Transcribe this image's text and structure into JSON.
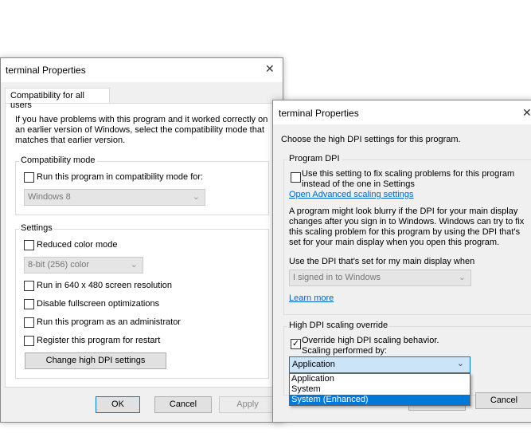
{
  "left_dialog": {
    "title": "terminal Properties",
    "tab": "Compatibility for all users",
    "intro": "If you have problems with this program and it worked correctly on an earlier version of Windows, select the compatibility mode that matches that earlier version.",
    "compat_group": "Compatibility mode",
    "compat_checkbox": "Run this program in compatibility mode for:",
    "compat_select": "Windows 8",
    "settings_group": "Settings",
    "reduced_color": "Reduced color mode",
    "color_select": "8-bit (256) color",
    "res640": "Run in 640 x 480 screen resolution",
    "fullscreen": "Disable fullscreen optimizations",
    "admin": "Run this program as an administrator",
    "restart": "Register this program for restart",
    "dpi_button": "Change high DPI settings",
    "ok": "OK",
    "cancel": "Cancel",
    "apply": "Apply"
  },
  "right_dialog": {
    "title": "terminal Properties",
    "heading": "Choose the high DPI settings for this program.",
    "program_dpi_group": "Program DPI",
    "program_dpi_checkbox": "Use this setting to fix scaling problems for this program instead of the one in Settings",
    "advanced_link": "Open Advanced scaling settings",
    "blurry_text": "A program might look blurry if the DPI for your main display changes after you sign in to Windows. Windows can try to fix this scaling problem for this program by using the DPI that's set for your main display when you open this program.",
    "use_dpi_label": "Use the DPI that's set for my main display when",
    "signin_select": "I signed in to Windows",
    "learn_more": "Learn more",
    "override_group": "High DPI scaling override",
    "override_checkbox": "Override high DPI scaling behavior.",
    "override_checked": true,
    "scaling_label": "Scaling performed by:",
    "scaling_select": "Application",
    "options": [
      "Application",
      "System",
      "System (Enhanced)"
    ],
    "highlighted_option": "System (Enhanced)",
    "cancel": "Cancel"
  }
}
